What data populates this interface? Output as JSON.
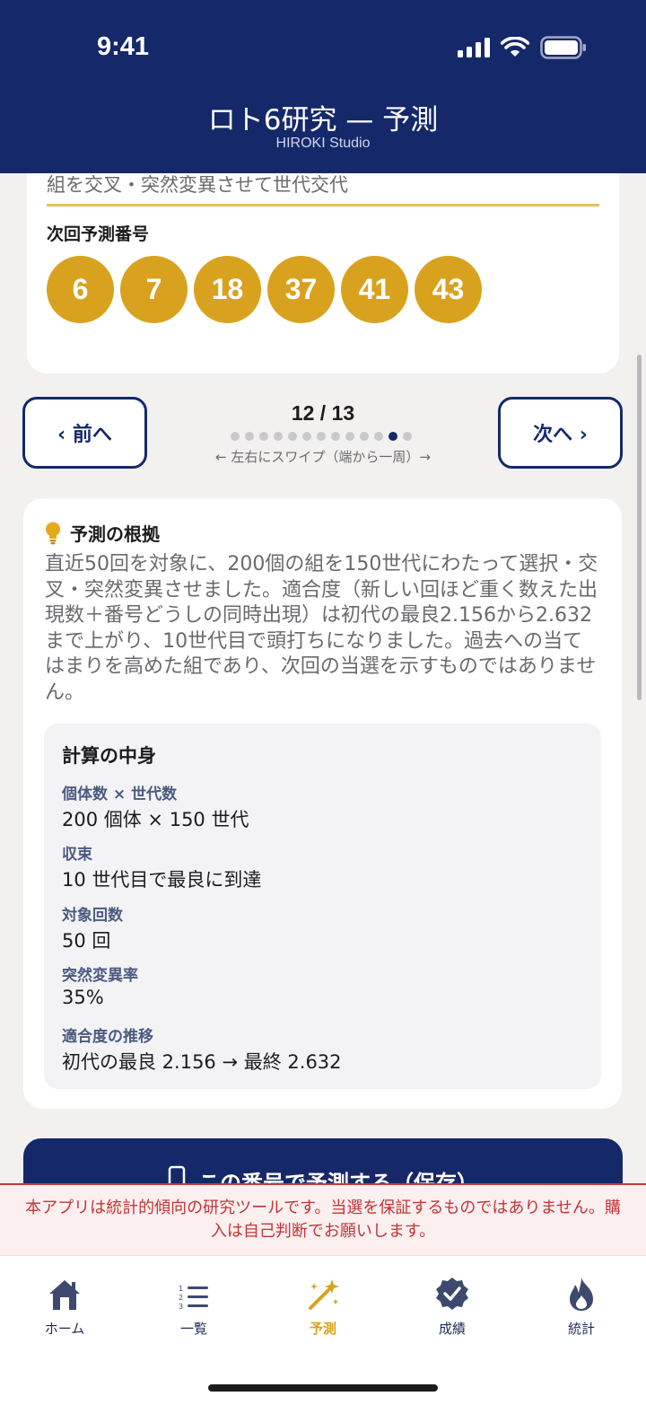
{
  "status_bar": {
    "time": "9:41"
  },
  "header": {
    "title": "ロト6研究 — 予測",
    "subtitle": "HIROKI Studio"
  },
  "top_card": {
    "cut_text": "組を交叉・突然変異させて世代交代",
    "next_label": "次回予測番号",
    "numbers": [
      "6",
      "7",
      "18",
      "37",
      "41",
      "43"
    ]
  },
  "pager": {
    "prev_label": "‹ 前へ",
    "next_label": "次へ ›",
    "count": "12 / 13",
    "current": 12,
    "total": 13,
    "hint": "← 左右にスワイプ（端から一周）→"
  },
  "basis": {
    "title": "予測の根拠",
    "text": "直近50回を対象に、200個の組を150世代にわたって選択・交叉・突然変異させました。適合度（新しい回ほど重く数えた出現数＋番号どうしの同時出現）は初代の最良2.156から2.632まで上がり、10世代目で頭打ちになりました。過去への当てはまりを高めた組であり、次回の当選を示すものではありません。",
    "calc": {
      "title": "計算の中身",
      "items": [
        {
          "label": "個体数 × 世代数",
          "value": "200 個体 × 150 世代"
        },
        {
          "label": "収束",
          "value": "10 世代目で最良に到達"
        },
        {
          "label": "対象回数",
          "value": "50 回"
        },
        {
          "label": "突然変異率",
          "value": "35%"
        },
        {
          "label": "適合度の推移",
          "value": "初代の最良 2.156 → 最終 2.632"
        }
      ]
    }
  },
  "save_button": {
    "label": "この番号で予測する（保存）"
  },
  "disclaimer": "本アプリは統計的傾向の研究ツールです。当選を保証するものではありません。購入は自己判断でお願いします。",
  "tabs": [
    {
      "label": "ホーム",
      "icon": "home-icon"
    },
    {
      "label": "一覧",
      "icon": "numbered-list-icon"
    },
    {
      "label": "予測",
      "icon": "magic-wand-icon",
      "active": true
    },
    {
      "label": "成績",
      "icon": "badge-check-icon"
    },
    {
      "label": "統計",
      "icon": "flame-icon"
    }
  ],
  "colors": {
    "navy": "#15296a",
    "gold": "#d9a21e",
    "warning": "#c23535"
  }
}
